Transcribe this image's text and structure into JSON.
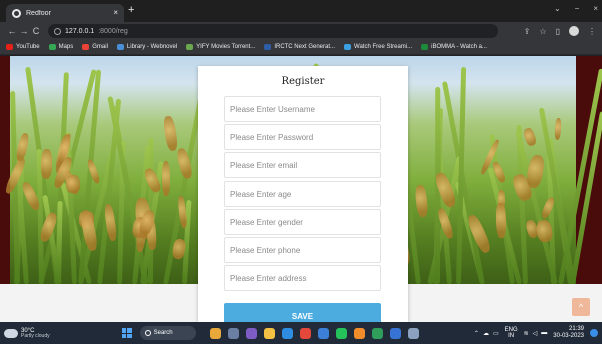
{
  "browser": {
    "tab_title": "Redfoor",
    "tab_close": "×",
    "new_tab": "+",
    "win_min": "−",
    "win_max": "⌄",
    "win_close": "×",
    "back": "←",
    "forward": "→",
    "reload": "C",
    "url_host": "127.0.0.1",
    "url_rest": ":8000/reg",
    "bookmarks": [
      {
        "label": "YouTube",
        "color": "#e62117"
      },
      {
        "label": "Maps",
        "color": "#34a853"
      },
      {
        "label": "Gmail",
        "color": "#ea4335"
      },
      {
        "label": "Library - Webnovel",
        "color": "#4a90d9"
      },
      {
        "label": "YIFY Movies Torrent...",
        "color": "#6aa84f"
      },
      {
        "label": "IRCTC Next Generat...",
        "color": "#2f5ea8"
      },
      {
        "label": "Watch Free Streami...",
        "color": "#3aa0e0"
      },
      {
        "label": "iBOMMA - Watch a...",
        "color": "#1e8a3b"
      }
    ]
  },
  "form": {
    "title": "Register",
    "fields": [
      {
        "name": "username",
        "placeholder": "Please Enter Username"
      },
      {
        "name": "password",
        "placeholder": "Please Enter Password"
      },
      {
        "name": "email",
        "placeholder": "Please Enter email"
      },
      {
        "name": "age",
        "placeholder": "Please Enter age"
      },
      {
        "name": "gender",
        "placeholder": "Please Enter gender"
      },
      {
        "name": "phone",
        "placeholder": "Please Enter phone"
      },
      {
        "name": "address",
        "placeholder": "Please Enter address"
      }
    ],
    "save_label": "SAVE",
    "accent": "#4cacdf"
  },
  "scroll_top": "^",
  "taskbar": {
    "temp": "30°C",
    "weather": "Partly cloudy",
    "search": "Search",
    "lang_1": "ENG",
    "lang_2": "IN",
    "time": "21:39",
    "date": "30-03-2023"
  }
}
